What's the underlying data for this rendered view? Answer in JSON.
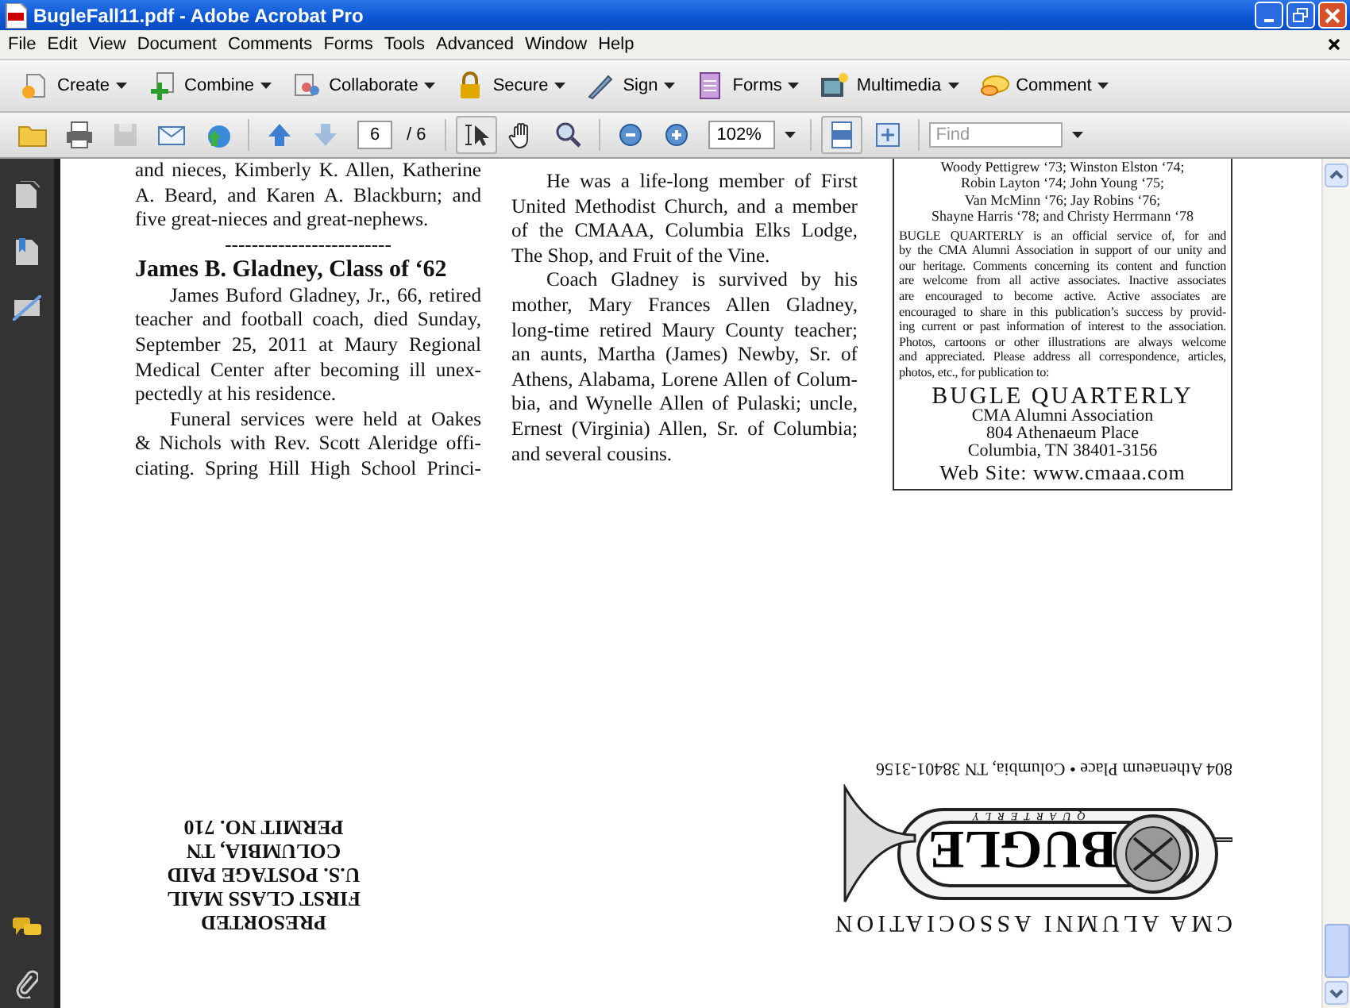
{
  "window": {
    "title": "BugleFall11.pdf - Adobe Acrobat Pro"
  },
  "menu": [
    "File",
    "Edit",
    "View",
    "Document",
    "Comments",
    "Forms",
    "Tools",
    "Advanced",
    "Window",
    "Help"
  ],
  "task_toolbar": [
    {
      "label": "Create"
    },
    {
      "label": "Combine"
    },
    {
      "label": "Collaborate"
    },
    {
      "label": "Secure"
    },
    {
      "label": "Sign"
    },
    {
      "label": "Forms"
    },
    {
      "label": "Multimedia"
    },
    {
      "label": "Comment"
    }
  ],
  "nav_toolbar": {
    "file_actions": [
      {
        "disabled": false
      },
      {
        "disabled": false
      },
      {
        "disabled": true
      },
      {
        "disabled": false
      },
      {
        "disabled": false
      }
    ],
    "page_nav": [
      {
        "disabled": false
      },
      {
        "disabled": true
      }
    ],
    "page_number": "6",
    "page_total": "/ 6",
    "tools": [
      {
        "selected": true
      },
      {
        "selected": false
      },
      {
        "selected": false
      }
    ],
    "zoom": "102%",
    "view_modes": [
      {
        "selected": true
      },
      {
        "selected": false
      }
    ],
    "find": {
      "placeholder": "Find"
    }
  },
  "document": {
    "column_1": [
      {
        "kind": "paragraph",
        "indent": false,
        "continued": false,
        "lines": [
          "and nieces, Kimberly K. Allen, Katherine",
          "A. Beard, and Karen A. Blackburn; and",
          "five great-nieces and great-nephews."
        ]
      },
      {
        "kind": "rule",
        "text": "-------------------------"
      },
      {
        "kind": "heading",
        "text": "James B. Gladney, Class of ‘62"
      },
      {
        "kind": "paragraph",
        "indent": true,
        "continued": false,
        "lines": [
          "James Buford Gladney, Jr., 66, retired",
          "teacher and football coach, died Sunday,",
          "September 25, 2011 at Maury Regional",
          "Medical Center after becoming ill unex-",
          "pectedly at his residence."
        ]
      },
      {
        "kind": "paragraph",
        "indent": true,
        "continued": true,
        "lines": [
          "Funeral services were held at Oakes",
          "& Nichols with Rev. Scott Aleridge offi-",
          "ciating. Spring Hill High School Princi-"
        ]
      }
    ],
    "column_2": [
      {
        "kind": "paragraph",
        "indent": true,
        "continued": false,
        "lines": [
          "He was a life-long member of First",
          "United Methodist Church, and a member",
          "of the CMAAA, Columbia Elks Lodge,",
          "The Shop, and Fruit of the Vine."
        ]
      },
      {
        "kind": "paragraph",
        "indent": true,
        "continued": false,
        "lines": [
          "Coach Gladney is survived by his",
          "mother, Mary Frances Allen Gladney,",
          "long-time retired Maury County teacher;",
          "an aunts, Martha (James) Newby, Sr. of",
          "Athens, Alabama, Lorene Allen of Colum-",
          "bia, and Wynelle Allen of Pulaski; uncle,",
          "Ernest (Virginia) Allen, Sr. of Columbia;",
          "and several cousins."
        ]
      }
    ],
    "masthead_box": {
      "staff_lines": [
        "Woody Pettigrew ‘73; Winston Elston ‘74;",
        "Robin Layton ‘74; John Young ‘75;",
        "Van McMinn ‘76; Jay Robins ‘76;",
        "Shayne Harris ‘78; and Christy Herrmann ‘78"
      ],
      "about_lines": [
        "BUGLE QUARTERLY is an official service of, for and",
        "by the CMA Alumni Association in support of our unity and",
        "our heritage. Comments concerning its content and function",
        "are welcome from all active associates. Inactive associates",
        "are encouraged to become active. Active associates are",
        "encouraged to share in this publication’s success by provid-",
        "ing current or past information of interest to the association.",
        "Photos, cartoons or other illustrations are always welcome",
        "and appreciated. Please address all correspondence, articles,",
        "photos, etc., for publication to:"
      ],
      "title": "BUGLE QUARTERLY",
      "address_lines": [
        "CMA Alumni Association",
        "804 Athenaeum Place",
        "Columbia, TN 38401-3156"
      ],
      "website": "Web Site: www.cmaaa.com"
    },
    "mailing_panel": {
      "postage_lines": [
        "PRESORTED",
        "FIRST CLASS MAIL",
        "U.S. POSTAGE PAID",
        "COLUMBIA, TN",
        "PERMIT NO. 710"
      ],
      "association": "CMA ALUMNI ASSOCIATION",
      "logo_word": "BUGLE",
      "logo_subword": "QUARTERLY",
      "return_address": "804 Athenaeum Place • Columbia, TN 38401-3156"
    }
  }
}
